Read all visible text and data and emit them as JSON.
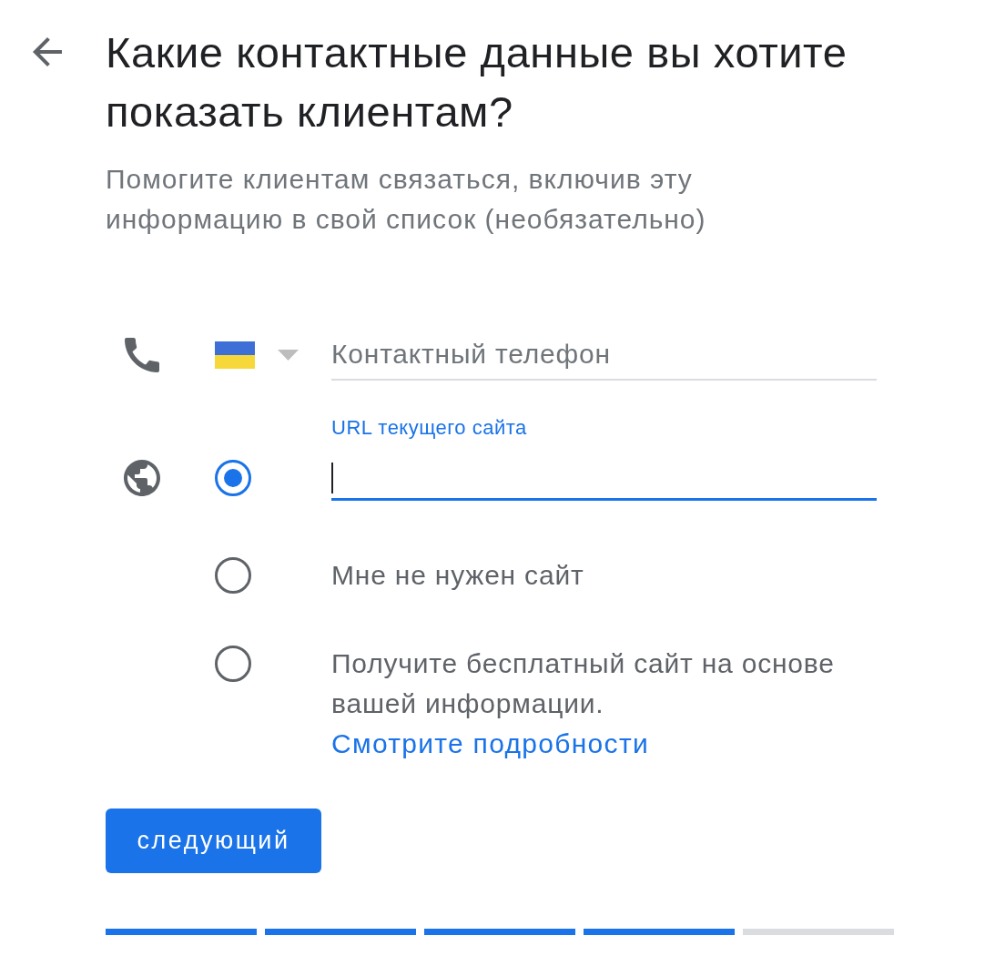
{
  "title": "Какие контактные данные вы хотите показать клиентам?",
  "subtitle": "Помогите клиентам связаться, включив эту информацию в свой список (необязательно)",
  "phone": {
    "placeholder": "Контактный телефон",
    "focused": false
  },
  "website": {
    "options": [
      {
        "kind": "url_field",
        "selected": true,
        "field": {
          "label": "URL текущего сайта",
          "focused": true
        }
      },
      {
        "kind": "text",
        "selected": false,
        "label": "Мне не нужен сайт"
      },
      {
        "kind": "text_with_link",
        "selected": false,
        "label": "Получите бесплатный сайт на основе вашей информации.",
        "link": "Смотрите подробности"
      }
    ]
  },
  "next_button": "следующий",
  "progress": {
    "steps": [
      {
        "completed": true
      },
      {
        "completed": true
      },
      {
        "completed": true
      },
      {
        "completed": true
      },
      {
        "completed": false
      }
    ]
  }
}
